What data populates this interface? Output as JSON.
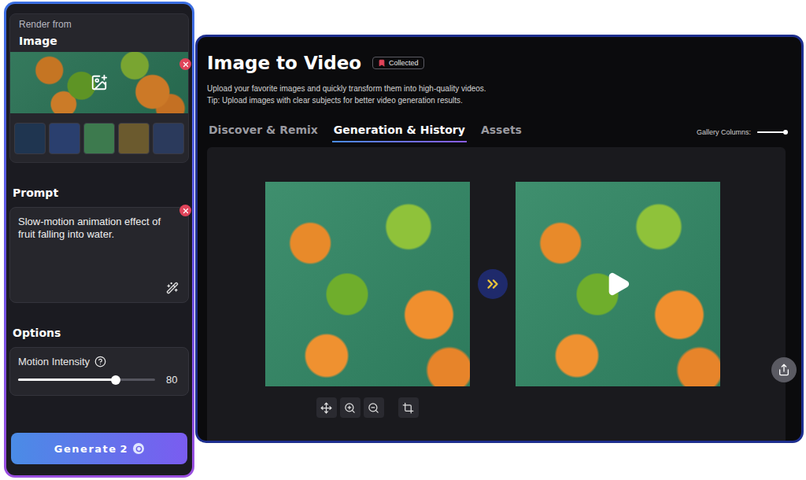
{
  "sidebar": {
    "render_from": {
      "label": "Render from",
      "title": "Image",
      "thumbnails": [
        {
          "color": "#1f3550",
          "selected": false
        },
        {
          "color": "#2a3f6e",
          "selected": false
        },
        {
          "color": "#3d7a4e",
          "selected": false
        },
        {
          "color": "#6b5a2e",
          "selected": false
        },
        {
          "color": "#2b3a5c",
          "selected": false
        }
      ]
    },
    "prompt": {
      "label": "Prompt",
      "text": "Slow-motion animation effect of fruit falling into water."
    },
    "options": {
      "label": "Options",
      "motion_intensity": {
        "label": "Motion Intensity",
        "level": 0.71,
        "reading": "80"
      }
    },
    "generate": {
      "label": "Generate",
      "cost": "2"
    }
  },
  "header": {
    "title": "Image to Video",
    "badge": "Collected",
    "description": "Upload your favorite images and quickly transform them into high-quality videos.",
    "tip": "Tip: Upload images with clear subjects for better video generation results."
  },
  "tabs": [
    {
      "label": "Discover & Remix",
      "selected": false
    },
    {
      "label": "Generation & History",
      "selected": true
    },
    {
      "label": "Assets",
      "selected": false
    }
  ],
  "gallery_columns": {
    "label": "Gallery Columns:",
    "level": 1
  }
}
